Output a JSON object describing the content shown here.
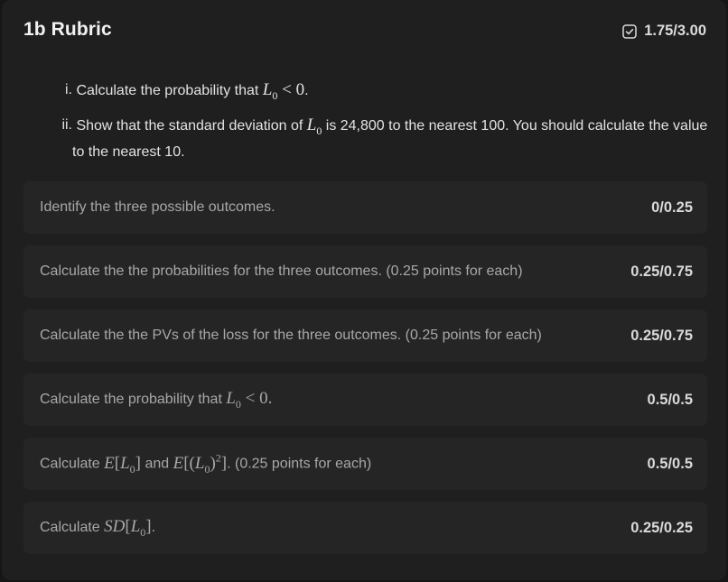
{
  "header": {
    "title": "1b Rubric",
    "total_score": "1.75/3.00",
    "total_icon": "checkbox-check-icon"
  },
  "question": {
    "items": [
      {
        "num": "i.",
        "pre": "Calculate the probability that ",
        "post": "."
      },
      {
        "num": "ii.",
        "pre": "Show that the standard deviation of ",
        "post": " is 24,800 to the nearest 100. You should calculate the value to the nearest 10."
      }
    ]
  },
  "rubric": {
    "items": [
      {
        "text": "Identify the three possible outcomes.",
        "score": "0/0.25"
      },
      {
        "text": "Calculate the the probabilities for the three outcomes. (0.25 points for each)",
        "score": "0.25/0.75"
      },
      {
        "text": "Calculate the the PVs of the loss for the three outcomes. (0.25 points for each)",
        "score": "0.25/0.75"
      },
      {
        "pre": "Calculate the probability that ",
        "post": "",
        "score": "0.5/0.5"
      },
      {
        "pre": "Calculate ",
        "mid": " and ",
        "post": ". (0.25 points for each)",
        "score": "0.5/0.5"
      },
      {
        "pre": "Calculate ",
        "post": ".",
        "score": "0.25/0.25"
      }
    ]
  },
  "colors": {
    "background": "#161616",
    "panel": "#1f1f1f",
    "row": "#252525",
    "text_primary": "#e2e2e2",
    "text_muted": "#a8a8a8"
  }
}
